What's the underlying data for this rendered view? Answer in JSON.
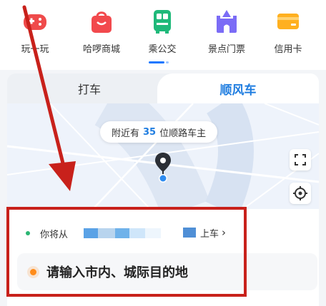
{
  "nav_items": [
    {
      "label": "玩一玩",
      "icon": "game-controller-icon",
      "color": "#ef4b4b"
    },
    {
      "label": "哈啰商城",
      "icon": "shopping-bag-icon",
      "color": "#f2494d"
    },
    {
      "label": "乘公交",
      "icon": "bus-icon",
      "color": "#1fb97a"
    },
    {
      "label": "景点门票",
      "icon": "castle-icon",
      "color": "#7b6cf6"
    },
    {
      "label": "信用卡",
      "icon": "credit-card-icon",
      "color": "#ffb020"
    }
  ],
  "tabs": {
    "taxi": "打车",
    "hitch": "顺风车"
  },
  "map": {
    "nearby_prefix": "附近有",
    "nearby_count": "35",
    "nearby_suffix": "位顺路车主"
  },
  "ride": {
    "from_label": "你将从",
    "board_label": "上车",
    "board_chevron": "›",
    "destination_placeholder": "请输入市内、城际目的地"
  },
  "colors": {
    "accent": "#1f7de0",
    "highlight": "#c8211b"
  }
}
